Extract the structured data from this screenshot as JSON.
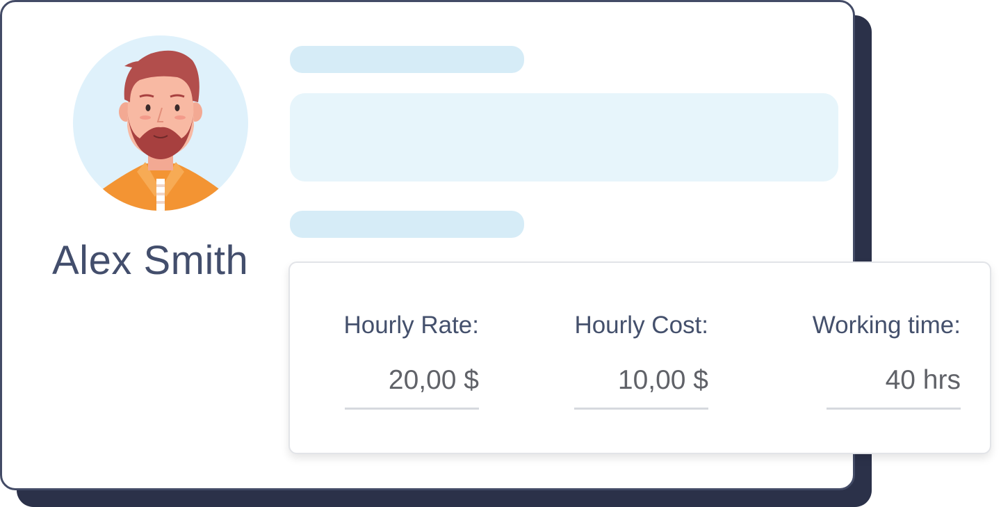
{
  "profile": {
    "name": "Alex Smith",
    "avatar_icon": "bearded-man-avatar"
  },
  "rates": {
    "hourly_rate_label": "Hourly Rate:",
    "hourly_rate_value": "20,00 $",
    "hourly_cost_label": "Hourly Cost:",
    "hourly_cost_value": "10,00 $",
    "working_time_label": "Working time:",
    "working_time_value": "40 hrs"
  },
  "colors": {
    "card_border": "#434b66",
    "card_shadow": "#2b3149",
    "placeholder": "#d6ecf7",
    "text_dark": "#44506c",
    "avatar_bg": "#dff1fb",
    "shirt": "#f39433",
    "hair": "#b24e4c"
  }
}
